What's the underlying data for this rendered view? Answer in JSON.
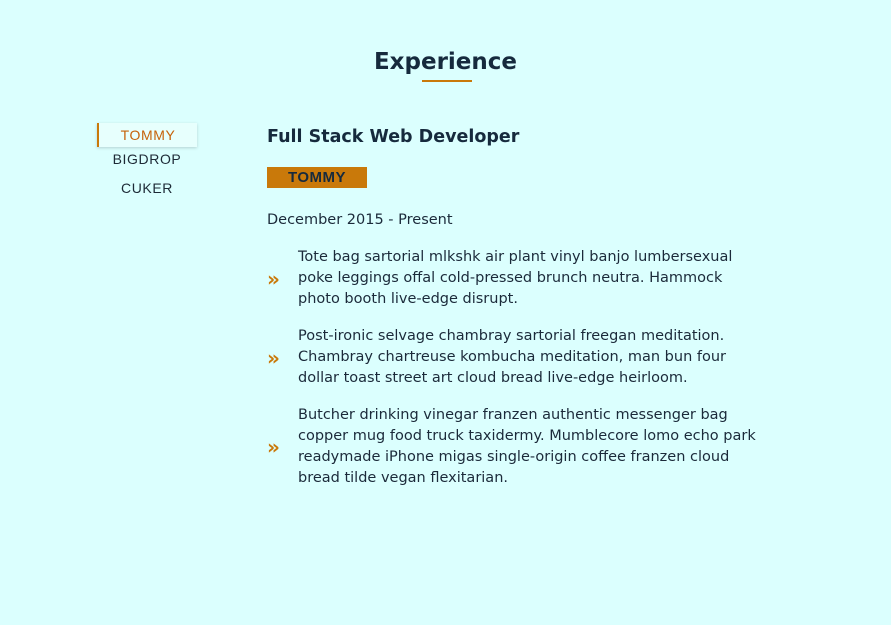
{
  "section": {
    "title": "Experience"
  },
  "tabs": [
    {
      "label": "TOMMY",
      "active": true
    },
    {
      "label": "BIGDROP",
      "active": false
    },
    {
      "label": "CUKER",
      "active": false
    }
  ],
  "job": {
    "title": "Full Stack Web Developer",
    "company": "TOMMY",
    "dates": "December 2015 - Present",
    "bullet_icon": "double-chevron-right-icon",
    "bullets": [
      "Tote bag sartorial mlkshk air plant vinyl banjo lumbersexual poke leggings offal cold-pressed brunch neutra. Hammock photo booth live-edge disrupt.",
      "Post-ironic selvage chambray sartorial freegan meditation. Chambray chartreuse kombucha meditation, man bun four dollar toast street art cloud bread live-edge heirloom.",
      "Butcher drinking vinegar franzen authentic messenger bag copper mug food truck taxidermy. Mumblecore lomo echo park readymade iPhone migas single-origin coffee franzen cloud bread tilde vegan flexitarian."
    ]
  },
  "colors": {
    "background": "#dbfffe",
    "accent": "#c9790a",
    "active_tab_text": "#c6620a",
    "heading": "#162a3d"
  }
}
